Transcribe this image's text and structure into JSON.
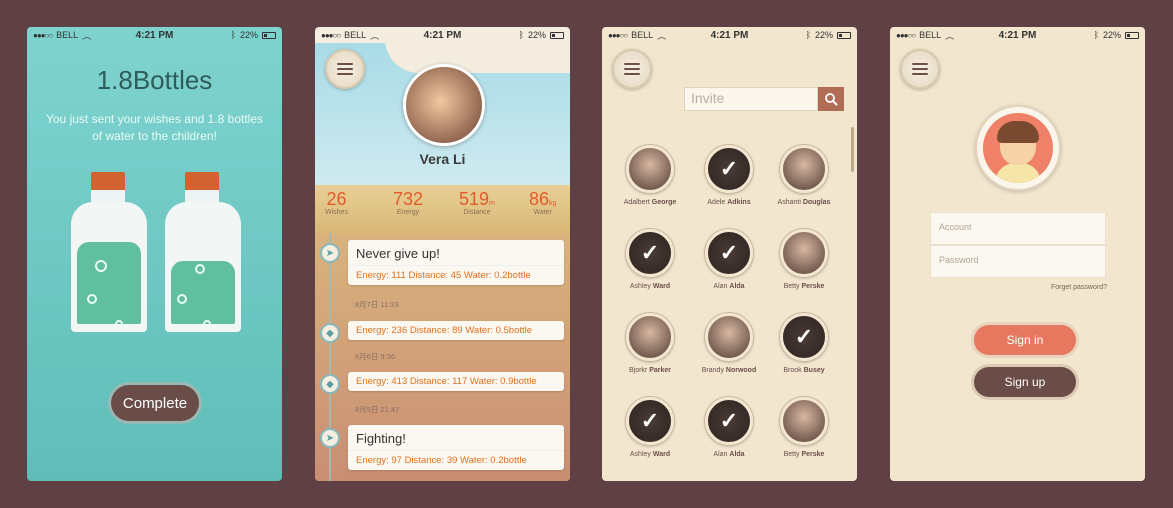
{
  "status": {
    "carrier": "BELL",
    "time": "4:21 PM",
    "battery": "22%"
  },
  "p1": {
    "title": "1.8Bottles",
    "subtitle": "You just sent your wishes and 1.8 bottles of water to the children!",
    "bottle_fill_levels": [
      0.72,
      0.55
    ],
    "button": "Complete"
  },
  "p2": {
    "name": "Vera Li",
    "stats": [
      {
        "value": "26",
        "unit": "",
        "label": "Wishes"
      },
      {
        "value": "732",
        "unit": "",
        "label": "Energy"
      },
      {
        "value": "519",
        "unit": "m",
        "label": "Distance"
      },
      {
        "value": "86",
        "unit": "kg",
        "label": "Water"
      }
    ],
    "cards": [
      {
        "title": "Never give up!",
        "meta": "Energy: 111   Distance: 45   Water: 0.2bottle",
        "date": "8月7日  11:33",
        "icon": "plane"
      },
      {
        "title": "",
        "meta": "Energy: 236   Distance: 89   Water: 0.5bottle",
        "date": "8月6日  9:36",
        "icon": "drop"
      },
      {
        "title": "",
        "meta": "Energy: 413   Distance: 117   Water: 0.9bottle",
        "date": "8月5日  21:47",
        "icon": "drop"
      },
      {
        "title": "Fighting!",
        "meta": "Energy: 97   Distance: 39   Water: 0.2bottle",
        "date": "",
        "icon": "plane"
      }
    ]
  },
  "p3": {
    "search_placeholder": "Invite",
    "contacts": [
      {
        "first": "Adalbert",
        "last": "George",
        "selected": false
      },
      {
        "first": "Adele",
        "last": "Adkins",
        "selected": true
      },
      {
        "first": "Ashanti",
        "last": "Douglas",
        "selected": false
      },
      {
        "first": "Ashley",
        "last": "Ward",
        "selected": true
      },
      {
        "first": "Alan",
        "last": "Alda",
        "selected": true
      },
      {
        "first": "Betty",
        "last": "Perske",
        "selected": false
      },
      {
        "first": "Bjorkr",
        "last": "Parker",
        "selected": false
      },
      {
        "first": "Brandy",
        "last": "Norwood",
        "selected": false
      },
      {
        "first": "Brook",
        "last": "Busey",
        "selected": true
      },
      {
        "first": "Ashley",
        "last": "Ward",
        "selected": true
      },
      {
        "first": "Alan",
        "last": "Alda",
        "selected": true
      },
      {
        "first": "Betty",
        "last": "Perske",
        "selected": false
      }
    ]
  },
  "p4": {
    "account_placeholder": "Account",
    "password_placeholder": "Password",
    "forgot": "Forget password?",
    "sign_in": "Sign in",
    "sign_up": "Sign up"
  }
}
